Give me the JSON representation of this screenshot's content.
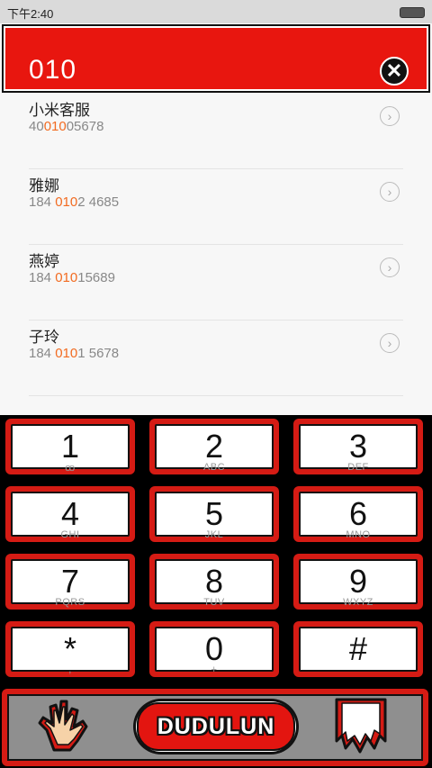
{
  "status_bar": {
    "time": "下午2:40"
  },
  "search": {
    "value": "010",
    "clear_symbol": "✕"
  },
  "contacts": [
    {
      "name": "小米客服",
      "num_pre": "40",
      "num_hl": "010",
      "num_post": "05678"
    },
    {
      "name": "雅娜",
      "num_pre": "184 ",
      "num_hl": "010",
      "num_post": "2 4685"
    },
    {
      "name": "燕婷",
      "num_pre": "184 ",
      "num_hl": "010",
      "num_post": "15689"
    },
    {
      "name": "子玲",
      "num_pre": "184 ",
      "num_hl": "010",
      "num_post": "1 5678"
    }
  ],
  "keys": [
    {
      "digit": "1",
      "letters": "ꝏ"
    },
    {
      "digit": "2",
      "letters": "ABC"
    },
    {
      "digit": "3",
      "letters": "DEF"
    },
    {
      "digit": "4",
      "letters": "GHI"
    },
    {
      "digit": "5",
      "letters": "JKL"
    },
    {
      "digit": "6",
      "letters": "MNO"
    },
    {
      "digit": "7",
      "letters": "PQRS"
    },
    {
      "digit": "8",
      "letters": "TUV"
    },
    {
      "digit": "9",
      "letters": "WXYZ"
    },
    {
      "digit": "*",
      "letters": ","
    },
    {
      "digit": "0",
      "letters": "+"
    },
    {
      "digit": "#",
      "letters": ""
    }
  ],
  "call_button": {
    "label": "DUDULUN"
  },
  "colors": {
    "accent_red": "#e8160f",
    "highlight_orange": "#f26b21"
  },
  "icons": {
    "left": "hand-gesture-icon",
    "right": "delete-icon"
  }
}
